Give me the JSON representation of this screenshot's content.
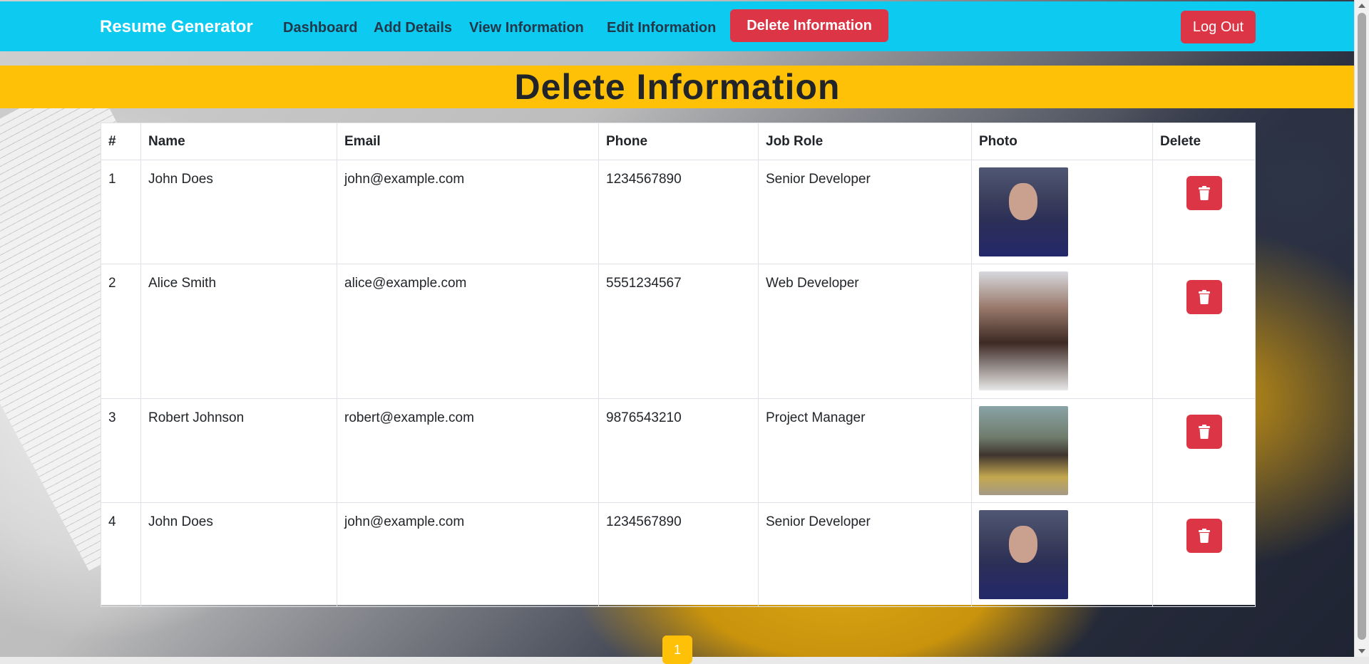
{
  "navbar": {
    "brand": "Resume Generator",
    "links": [
      "Dashboard",
      "Add Details",
      "View Information",
      "Edit Information"
    ],
    "active": "Delete Information",
    "logout": "Log Out"
  },
  "page": {
    "title": "Delete Information"
  },
  "table": {
    "headers": [
      "#",
      "Name",
      "Email",
      "Phone",
      "Job Role",
      "Photo",
      "Delete"
    ],
    "rows": [
      {
        "num": "1",
        "name": "John Does",
        "email": "john@example.com",
        "phone": "1234567890",
        "role": "Senior Developer",
        "photo": "man-in-suit-photo"
      },
      {
        "num": "2",
        "name": "Alice Smith",
        "email": "alice@example.com",
        "phone": "5551234567",
        "role": "Web Developer",
        "photo": "woman-portrait-photo"
      },
      {
        "num": "3",
        "name": "Robert Johnson",
        "email": "robert@example.com",
        "phone": "9876543210",
        "role": "Project Manager",
        "photo": "young-man-hoodie-photo"
      },
      {
        "num": "4",
        "name": "John Does",
        "email": "john@example.com",
        "phone": "1234567890",
        "role": "Senior Developer",
        "photo": "man-in-suit-photo"
      }
    ]
  },
  "pagination": {
    "current": "1"
  },
  "colors": {
    "navbar": "#0dcaf0",
    "danger": "#dc3545",
    "warning": "#ffc107"
  }
}
